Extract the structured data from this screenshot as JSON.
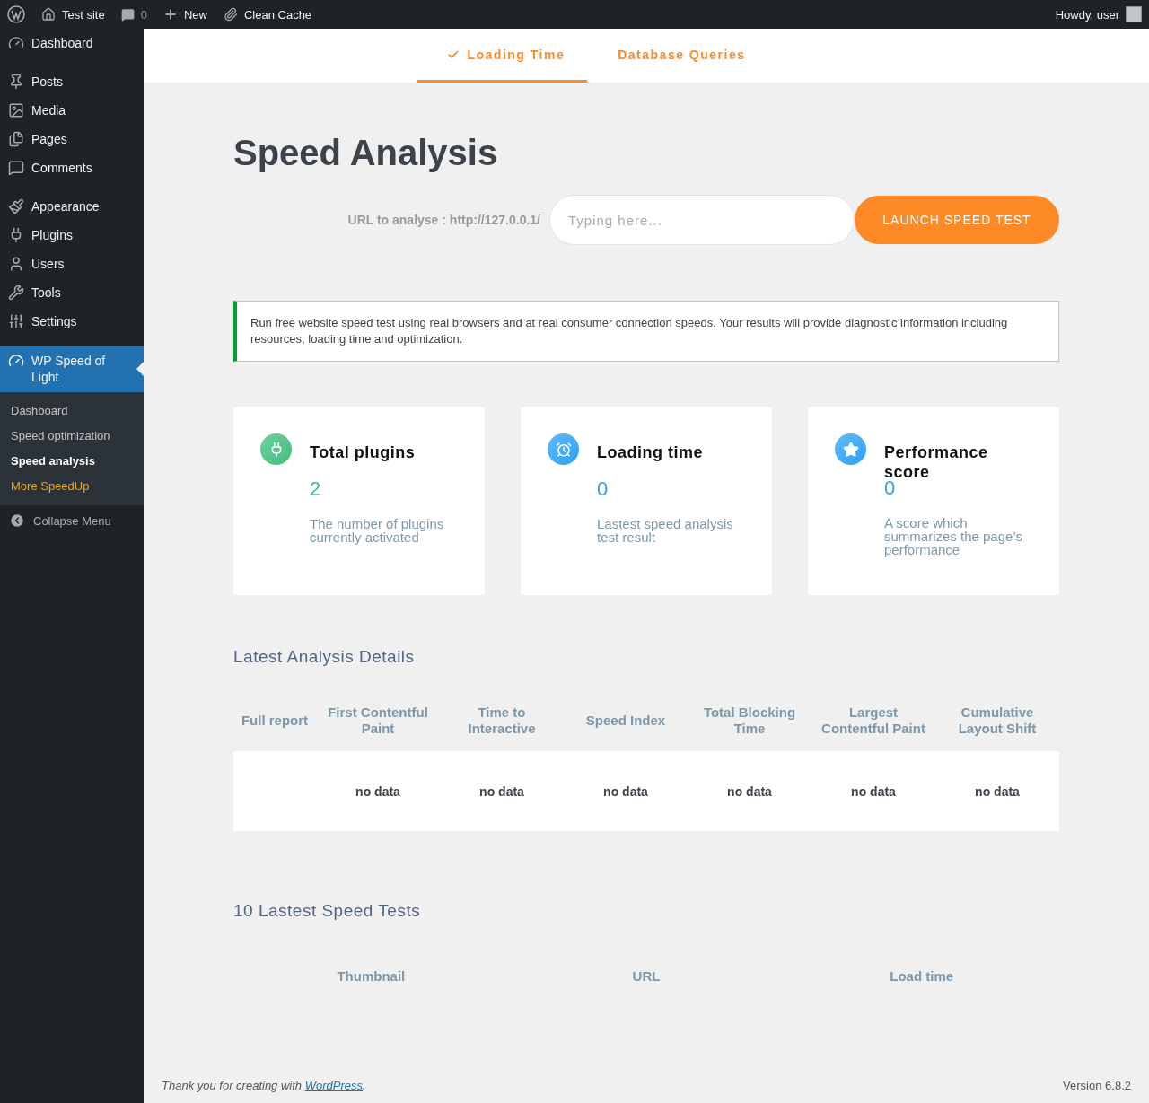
{
  "admin_bar": {
    "site": "Test site",
    "comments": "0",
    "new": "New",
    "cache": "Clean Cache",
    "greeting": "Howdy, user"
  },
  "sidebar": {
    "groups": [
      {
        "items": [
          {
            "label": "Dashboard",
            "kind": "dashboard",
            "selected": false
          }
        ]
      },
      {
        "items": [
          {
            "label": "Posts",
            "kind": "posts",
            "selected": false
          },
          {
            "label": "Media",
            "kind": "media",
            "selected": false
          },
          {
            "label": "Pages",
            "kind": "pages",
            "selected": false
          },
          {
            "label": "Comments",
            "kind": "comments",
            "selected": false
          }
        ]
      },
      {
        "items": [
          {
            "label": "Appearance",
            "kind": "appearance",
            "selected": false
          },
          {
            "label": "Plugins",
            "kind": "plugins",
            "selected": false
          },
          {
            "label": "Users",
            "kind": "users",
            "selected": false
          },
          {
            "label": "Tools",
            "kind": "tools",
            "selected": false
          },
          {
            "label": "Settings",
            "kind": "settings",
            "selected": false
          }
        ]
      },
      {
        "items": [
          {
            "label": "WP Speed of Light",
            "kind": "speed",
            "selected": true,
            "children": [
              {
                "label": "Dashboard",
                "kind": "link",
                "selected": false
              },
              {
                "label": "Speed optimization",
                "kind": "link",
                "selected": false
              },
              {
                "label": "Speed analysis",
                "kind": "link",
                "selected": true
              },
              {
                "label": "More SpeedUp",
                "kind": "promo",
                "selected": false
              }
            ]
          }
        ]
      }
    ],
    "collapse": "Collapse Menu"
  },
  "tabs": [
    {
      "label": "Loading Time",
      "selected": true
    },
    {
      "label": "Database Queries",
      "selected": false
    }
  ],
  "title": "Speed Analysis",
  "url_form": {
    "label": "URL to analyse : http://127.0.0.1/",
    "placeholder": "Typing here...",
    "button": "LAUNCH SPEED TEST"
  },
  "notice": "Run free website speed test using real browsers and at real consumer connection speeds. Your results will provide diagnostic information including resources, loading time and optimization.",
  "cards": [
    {
      "kind": "plugins",
      "title": "Total plugins",
      "value": "2",
      "description": "The number of plugins currently activated",
      "color": "#3dbf7a"
    },
    {
      "kind": "time",
      "title": "Loading time",
      "value": "0",
      "description": "Lastest speed analysis test result",
      "color": "#2aa1f5"
    },
    {
      "kind": "score",
      "title": "Performance score",
      "value": "0",
      "description": "A score which summarizes the page’s performance",
      "color": "#2aa1f5"
    }
  ],
  "details": {
    "title": "Latest Analysis Details",
    "columns": [
      "Full report",
      "First Contentful Paint",
      "Time to Interactive",
      "Speed Index",
      "Total Blocking Time",
      "Largest Contentful Paint",
      "Cumulative Layout Shift"
    ],
    "rows": [
      [
        "",
        "no data",
        "no data",
        "no data",
        "no data",
        "no data",
        "no data"
      ]
    ]
  },
  "latest": {
    "title": "10 Lastest Speed Tests",
    "columns": [
      "Thumbnail",
      "URL",
      "Load time"
    ]
  },
  "footer": {
    "before": "Thank you for creating with ",
    "link": "WordPress",
    "after": ".",
    "version": "Version 6.8.2"
  }
}
